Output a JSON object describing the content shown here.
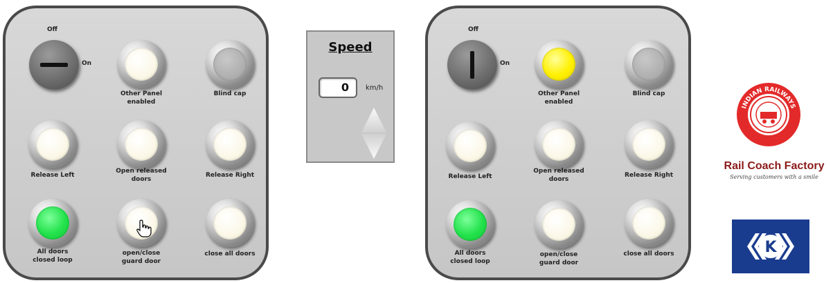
{
  "left_panel": {
    "switch_off": "Off",
    "switch_on": "On",
    "buttons": {
      "other_panel": [
        "Other Panel",
        "enabled"
      ],
      "blind_cap": "Blind cap",
      "release_left": "Release Left",
      "open_released": [
        "Open released",
        "doors"
      ],
      "release_right": "Release Right",
      "all_doors_closed": [
        "All doors",
        "closed loop"
      ],
      "guard_door": [
        "open/close",
        "guard door"
      ],
      "close_all": "close all doors"
    },
    "switch_state": "off",
    "lamp_states": {
      "other_panel": "off",
      "blind_cap": "gray",
      "release_left": "off",
      "open_released": "off",
      "release_right": "off",
      "all_doors_closed": "green",
      "guard_door": "off",
      "close_all": "off"
    }
  },
  "right_panel": {
    "switch_off": "Off",
    "switch_on": "On",
    "buttons": {
      "other_panel": [
        "Other Panel",
        "enabled"
      ],
      "blind_cap": "Blind cap",
      "release_left": "Release Left",
      "open_released": [
        "Open released",
        "doors"
      ],
      "release_right": "Release Right",
      "all_doors_closed": [
        "All doors",
        "closed loop"
      ],
      "guard_door": [
        "open/close",
        "guard door"
      ],
      "close_all": "close all doors"
    },
    "switch_state": "on",
    "lamp_states": {
      "other_panel": "yellow",
      "blind_cap": "gray",
      "release_left": "off",
      "open_released": "off",
      "release_right": "off",
      "all_doors_closed": "green",
      "guard_door": "off",
      "close_all": "off"
    }
  },
  "speed": {
    "title": "Speed",
    "value": "0",
    "unit": "km/h"
  },
  "logos": {
    "ir_ring_text": "INDIAN RAILWAYS",
    "rcf_name": "Rail Coach Factory",
    "rcf_tagline": "Serving customers with a smile",
    "k_letter": "K"
  },
  "colors": {
    "lamp_green": "#22e24b",
    "lamp_yellow": "#fff000",
    "ir_red": "#e32a2a",
    "k_blue": "#1a3c8f"
  },
  "icons": [
    "key-switch-icon",
    "arrow-up-icon",
    "arrow-down-icon",
    "hand-cursor-icon",
    "indian-railways-logo",
    "knorr-bremse-logo"
  ]
}
